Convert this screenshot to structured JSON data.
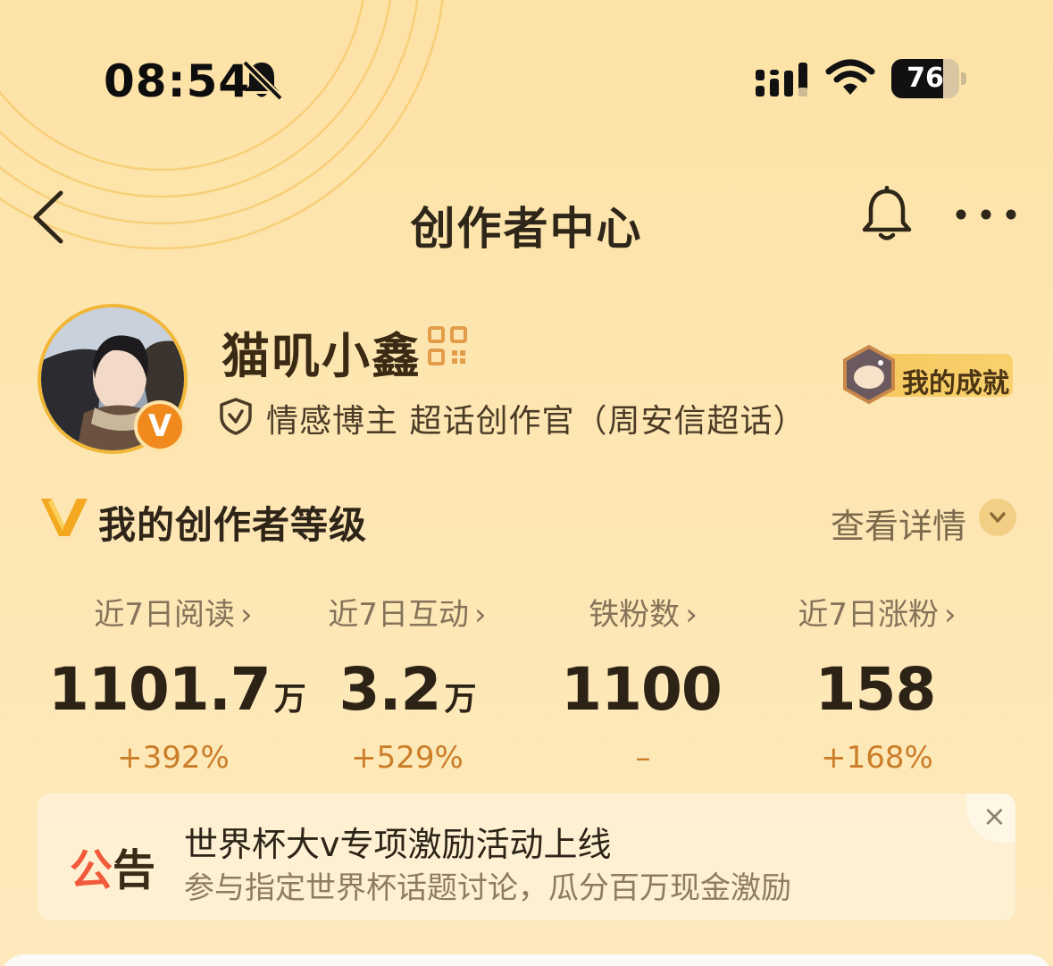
{
  "status_bar": {
    "time": "08:54",
    "battery_level": "76",
    "icons": [
      "bell-slash-icon",
      "cellular-signal-icon",
      "wifi-icon",
      "battery-icon"
    ]
  },
  "nav": {
    "title": "创作者中心",
    "icons": [
      "back-chevron-icon",
      "bell-icon",
      "more-dots-icon"
    ]
  },
  "profile": {
    "name": "猫叽小鑫",
    "bio": "情感博主 超话创作官（周安信超话）",
    "verified_badge": "V",
    "achievement_label": "我的成就"
  },
  "level": {
    "title": "我的创作者等级",
    "detail_link": "查看详情"
  },
  "stats": [
    {
      "label": "近7日阅读",
      "value": "1101.7",
      "unit": "万",
      "change": "+392%"
    },
    {
      "label": "近7日互动",
      "value": "3.2",
      "unit": "万",
      "change": "+529%"
    },
    {
      "label": "铁粉数",
      "value": "1100",
      "unit": "",
      "change": "–"
    },
    {
      "label": "近7日涨粉",
      "value": "158",
      "unit": "",
      "change": "+168%"
    }
  ],
  "notice": {
    "tag_first": "公",
    "tag_second": "告",
    "title": "世界杯大v专项激励活动上线",
    "subtitle": "参与指定世界杯话题讨论，瓜分百万现金激励",
    "close_glyph": "×"
  },
  "colors": {
    "background": "#fde2a6",
    "accent_orange": "#cb7d28",
    "notice_red": "#f15a3a",
    "avatar_ring": "#f2b737"
  }
}
